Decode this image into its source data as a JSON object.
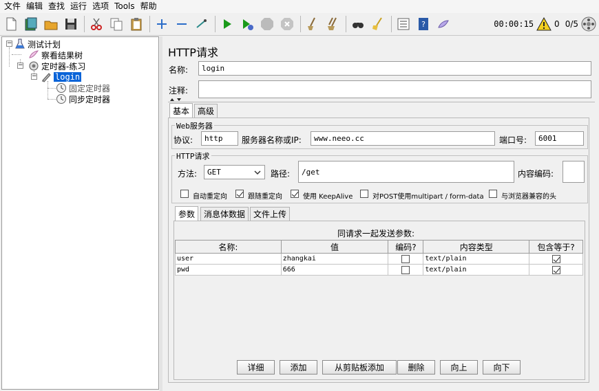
{
  "menu": [
    "文件",
    "编辑",
    "查找",
    "运行",
    "选项",
    "Tools",
    "帮助"
  ],
  "toolbar": {
    "timer": "00:00:15",
    "warning_count": "0",
    "threads": "0/5"
  },
  "tree": {
    "root": "测试计划",
    "listener": "察看结果树",
    "thread_group": "定时器-练习",
    "sampler": "login",
    "timer1": "固定定时器",
    "timer2": "同步定时器"
  },
  "panel": {
    "title": "HTTP请求",
    "name_label": "名称:",
    "name_value": "login",
    "comment_label": "注释:",
    "comment_value": "",
    "tabs": [
      "基本",
      "高级"
    ],
    "web_server_group": "Web服务器",
    "protocol_label": "协议:",
    "protocol_value": "http",
    "server_label": "服务器名称或IP:",
    "server_value": "www.neeo.cc",
    "port_label": "端口号:",
    "port_value": "6001",
    "http_group": "HTTP请求",
    "method_label": "方法:",
    "method_value": "GET",
    "path_label": "路径:",
    "path_value": "/get",
    "encoding_label": "内容编码:",
    "encoding_value": "",
    "options": [
      {
        "label": "自动重定向",
        "checked": false
      },
      {
        "label": "跟随重定向",
        "checked": true
      },
      {
        "label": "使用 KeepAlive",
        "checked": true
      },
      {
        "label": "对POST使用multipart / form-data",
        "checked": false
      },
      {
        "label": "与浏览器兼容的头",
        "checked": false
      }
    ],
    "sub_tabs": [
      "参数",
      "消息体数据",
      "文件上传"
    ],
    "params_caption": "同请求一起发送参数:",
    "columns": [
      "名称:",
      "值",
      "编码?",
      "内容类型",
      "包含等于?"
    ],
    "rows": [
      {
        "name": "user",
        "value": "zhangkai",
        "encode": false,
        "content_type": "text/plain",
        "include_equals": true
      },
      {
        "name": "pwd",
        "value": "666",
        "encode": false,
        "content_type": "text/plain",
        "include_equals": true
      }
    ],
    "buttons": [
      "详细",
      "添加",
      "从剪贴板添加",
      "删除",
      "向上",
      "向下"
    ]
  }
}
